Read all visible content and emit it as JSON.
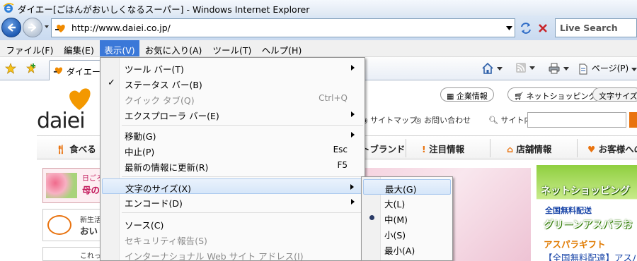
{
  "window": {
    "title": "ダイエー[ごはんがおいしくなるスーパー] - Windows Internet Explorer"
  },
  "address_bar": {
    "url": "http://www.daiei.co.jp/"
  },
  "search": {
    "placeholder": "Live Search"
  },
  "menubar": {
    "items": [
      {
        "label": "ファイル(F)"
      },
      {
        "label": "編集(E)"
      },
      {
        "label": "表示(V)"
      },
      {
        "label": "お気に入り(A)"
      },
      {
        "label": "ツール(T)"
      },
      {
        "label": "ヘルプ(H)"
      }
    ]
  },
  "tab": {
    "label": "ダイエー"
  },
  "command_bar": {
    "page_label": "ページ(P)"
  },
  "view_menu": {
    "items": [
      {
        "label": "ツール バー(T)"
      },
      {
        "label": "ステータス バー(B)"
      },
      {
        "label": "クイック タブ(Q)",
        "shortcut": "Ctrl+Q"
      },
      {
        "label": "エクスプローラ バー(E)"
      },
      {
        "label": "移動(G)"
      },
      {
        "label": "中止(P)",
        "shortcut": "Esc"
      },
      {
        "label": "最新の情報に更新(R)",
        "shortcut": "F5"
      },
      {
        "label": "文字のサイズ(X)"
      },
      {
        "label": "エンコード(D)"
      },
      {
        "label": "ソース(C)"
      },
      {
        "label": "セキュリティ報告(S)"
      },
      {
        "label": "インターナショナル Web サイト アドレス(I)"
      }
    ]
  },
  "text_size_menu": {
    "items": [
      {
        "label": "最大(G)"
      },
      {
        "label": "大(L)"
      },
      {
        "label": "中(M)"
      },
      {
        "label": "小(S)"
      },
      {
        "label": "最小(A)"
      }
    ]
  },
  "page": {
    "logo_text": "daiei",
    "top_links": [
      "企業情報",
      "ネットショッピング",
      "文字サイズの"
    ],
    "utility_links": [
      "サイトマップ",
      "お問い合わせ",
      "サイト内"
    ],
    "categories": [
      "食べる",
      "トブランド",
      "注目情報",
      "店舗情報",
      "お客様への"
    ],
    "left_boxes": [
      {
        "line1": "日ごろ",
        "line2": "母の"
      },
      {
        "line1": "新生活",
        "line2": "おい"
      },
      {
        "line1": "これっ"
      }
    ],
    "net_shopping": {
      "heading": "ネットショッピング",
      "label1": "全国無料配送",
      "label2": "グリーンアスパラお",
      "label3": "アスパラギフト",
      "label4": "【全国無料配達】アスパ"
    }
  }
}
